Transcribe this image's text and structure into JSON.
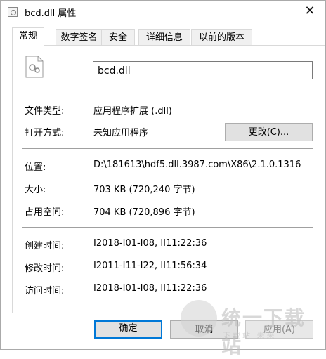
{
  "window": {
    "title": "bcd.dll 属性",
    "close_glyph": "✕"
  },
  "tabs": [
    {
      "label": "常规",
      "active": true
    },
    {
      "label": "数字签名",
      "active": false
    },
    {
      "label": "安全",
      "active": false
    },
    {
      "label": "详细信息",
      "active": false
    },
    {
      "label": "以前的版本",
      "active": false
    }
  ],
  "general": {
    "file_name": "bcd.dll",
    "file_type_label": "文件类型:",
    "file_type_value": "应用程序扩展 (.dll)",
    "open_with_label": "打开方式:",
    "open_with_value": "未知应用程序",
    "change_button": "更改(C)...",
    "location_label": "位置:",
    "location_value": "D:\\181613\\hdf5.dll.3987.com\\X86\\2.1.0.1316",
    "size_label": "大小:",
    "size_value": "703 KB (720,240 字节)",
    "size_on_disk_label": "占用空间:",
    "size_on_disk_value": "704 KB (720,896 字节)",
    "created_label": "创建时间:",
    "created_value": "I2018-I01-I08, II11:22:36",
    "modified_label": "修改时间:",
    "modified_value": "I2011-I11-I22, II11:56:34",
    "accessed_label": "访问时间:",
    "accessed_value": "I2018-I01-I08, II11:22:36"
  },
  "buttons": {
    "ok": "确定",
    "cancel": "取消",
    "apply": "应用(A)"
  },
  "watermark": {
    "text": "统一下载站",
    "sub": "下载站 未来"
  }
}
